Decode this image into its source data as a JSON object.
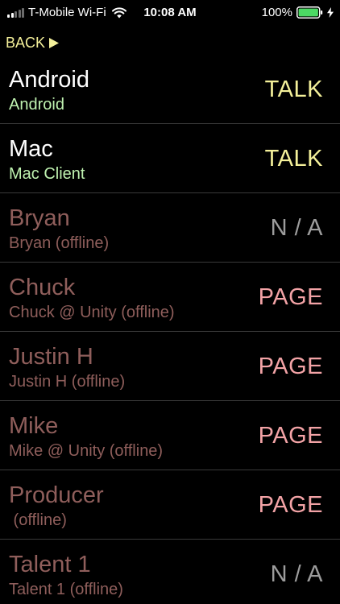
{
  "status_bar": {
    "carrier": "T-Mobile Wi-Fi",
    "time": "10:08 AM",
    "battery_percent": "100%",
    "signal_level": 2,
    "signal_max": 5,
    "battery_fill": 1.0,
    "icons": [
      "signal-bars-icon",
      "wifi-icon",
      "battery-icon",
      "charging-bolt-icon"
    ],
    "colors": {
      "battery": "#4cd964"
    }
  },
  "nav": {
    "back_label": "BACK",
    "back_icon": "play-arrow-icon",
    "color": "#f4f09a"
  },
  "contacts": [
    {
      "name": "Android",
      "subtitle": "Android",
      "action": "TALK",
      "state": "online",
      "action_kind": "talk"
    },
    {
      "name": "Mac",
      "subtitle": "Mac Client",
      "action": "TALK",
      "state": "online",
      "action_kind": "talk"
    },
    {
      "name": "Bryan",
      "subtitle": "Bryan (offline)",
      "action": "N / A",
      "state": "offline",
      "action_kind": "na"
    },
    {
      "name": "Chuck",
      "subtitle": "Chuck @ Unity (offline)",
      "action": "PAGE",
      "state": "offline",
      "action_kind": "page"
    },
    {
      "name": "Justin H",
      "subtitle": "Justin H (offline)",
      "action": "PAGE",
      "state": "offline",
      "action_kind": "page"
    },
    {
      "name": "Mike",
      "subtitle": "Mike @ Unity (offline)",
      "action": "PAGE",
      "state": "offline",
      "action_kind": "page"
    },
    {
      "name": "Producer",
      "subtitle": " (offline)",
      "action": "PAGE",
      "state": "offline",
      "action_kind": "page"
    },
    {
      "name": "Talent 1",
      "subtitle": "Talent 1 (offline)",
      "action": "N / A",
      "state": "offline",
      "action_kind": "na"
    }
  ],
  "colors": {
    "background": "#000000",
    "online_name": "#ffffff",
    "online_subtitle": "#bff2b0",
    "offline_text": "#8f5e5b",
    "talk": "#f4f09a",
    "page": "#f3a3a6",
    "na": "#9c9c9c",
    "divider": "#3a3a3a"
  }
}
